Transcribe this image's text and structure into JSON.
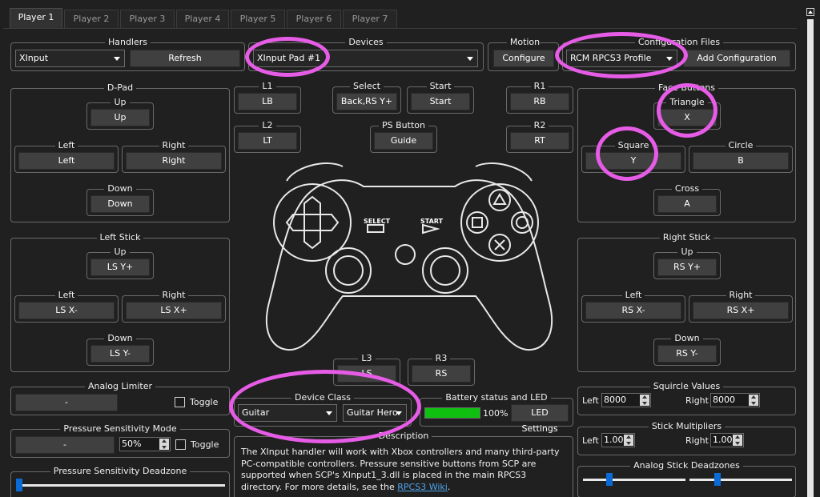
{
  "tabs": [
    "Player 1",
    "Player 2",
    "Player 3",
    "Player 4",
    "Player 5",
    "Player 6",
    "Player 7"
  ],
  "handlers": {
    "title": "Handlers",
    "value": "XInput",
    "refresh": "Refresh"
  },
  "devices": {
    "title": "Devices",
    "value": "XInput Pad #1"
  },
  "motion": {
    "title": "Motion Controls",
    "configure": "Configure"
  },
  "config_files": {
    "title": "Configuration Files",
    "value": "RCM RPCS3 Profile",
    "add": "Add Configuration"
  },
  "dpad": {
    "title": "D-Pad",
    "up_label": "Up",
    "up": "Up",
    "left_label": "Left",
    "left": "Left",
    "right_label": "Right",
    "right": "Right",
    "down_label": "Down",
    "down": "Down"
  },
  "left_stick": {
    "title": "Left Stick",
    "up_label": "Up",
    "up": "LS Y+",
    "left_label": "Left",
    "left": "LS X-",
    "right_label": "Right",
    "right": "LS X+",
    "down_label": "Down",
    "down": "LS Y-"
  },
  "face": {
    "title": "Face Buttons",
    "triangle_label": "Triangle",
    "triangle": "X",
    "square_label": "Square",
    "square": "Y",
    "circle_label": "Circle",
    "circle": "B",
    "cross_label": "Cross",
    "cross": "A"
  },
  "right_stick": {
    "title": "Right Stick",
    "up_label": "Up",
    "up": "RS Y+",
    "left_label": "Left",
    "left": "RS X-",
    "right_label": "Right",
    "right": "RS X+",
    "down_label": "Down",
    "down": "RS Y-"
  },
  "center": {
    "l1_label": "L1",
    "l1": "LB",
    "select_label": "Select",
    "select": "Back,RS Y+",
    "start_label": "Start",
    "start": "Start",
    "r1_label": "R1",
    "r1": "RB",
    "l2_label": "L2",
    "l2": "LT",
    "ps_label": "PS Button",
    "ps": "Guide",
    "r2_label": "R2",
    "r2": "RT",
    "l3_label": "L3",
    "l3": "LS",
    "r3_label": "R3",
    "r3": "RS",
    "pad_select": "SELECT",
    "pad_start": "START"
  },
  "analog_limiter": {
    "title": "Analog Limiter",
    "value": "-",
    "toggle": "Toggle"
  },
  "pressure_mode": {
    "title": "Pressure Sensitivity Mode",
    "value": "-",
    "percent": "50%",
    "toggle": "Toggle"
  },
  "pressure_deadzone": {
    "title": "Pressure Sensitivity Deadzone",
    "level": 0
  },
  "device_class": {
    "title": "Device Class",
    "class": "Guitar",
    "subtype": "Guitar Hero"
  },
  "battery": {
    "title": "Battery status and LED",
    "percent": "100%",
    "level": 1.0,
    "led": "LED Settings"
  },
  "description": {
    "title": "Description",
    "text": "The XInput handler will work with Xbox controllers and many third-party PC-compatible controllers. Pressure sensitive buttons from SCP are supported when SCP's XInput1_3.dll is placed in the main RPCS3 directory. For more details, see the ",
    "link": "RPCS3 Wiki",
    "end": "."
  },
  "squircle": {
    "title": "Squircle Values",
    "left_label": "Left",
    "left": "8000",
    "right_label": "Right",
    "right": "8000"
  },
  "stick_mult": {
    "title": "Stick Multipliers",
    "left_label": "Left",
    "left": "1.00",
    "right_label": "Right",
    "right": "1.00"
  },
  "stick_deadzones": {
    "title": "Analog Stick Deadzones",
    "left_level": 0.24,
    "right_level": 0.26
  },
  "colors": {
    "background": "#202020",
    "button": "#404040",
    "battery": "#10c010",
    "slider": "#0a6ad6",
    "link": "#4ea5ef",
    "highlight": "#e65ce6"
  }
}
